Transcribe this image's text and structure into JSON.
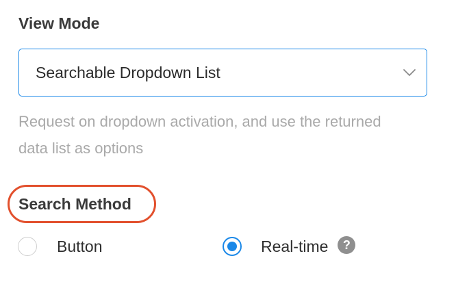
{
  "view_mode": {
    "label": "View Mode",
    "selected_value": "Searchable Dropdown List",
    "dropdown_icon": "chevron-down-icon",
    "help_text": "Request on dropdown activation, and use the returned data list as options"
  },
  "search_method": {
    "label": "Search Method",
    "options": [
      {
        "label": "Button",
        "checked": false
      },
      {
        "label": "Real-time",
        "checked": true
      }
    ],
    "help_icon": "question-mark-icon",
    "help_icon_glyph": "?"
  },
  "colors": {
    "accent": "#1a88e8",
    "highlight": "#e2502d",
    "help_text": "#a9a9a9"
  }
}
